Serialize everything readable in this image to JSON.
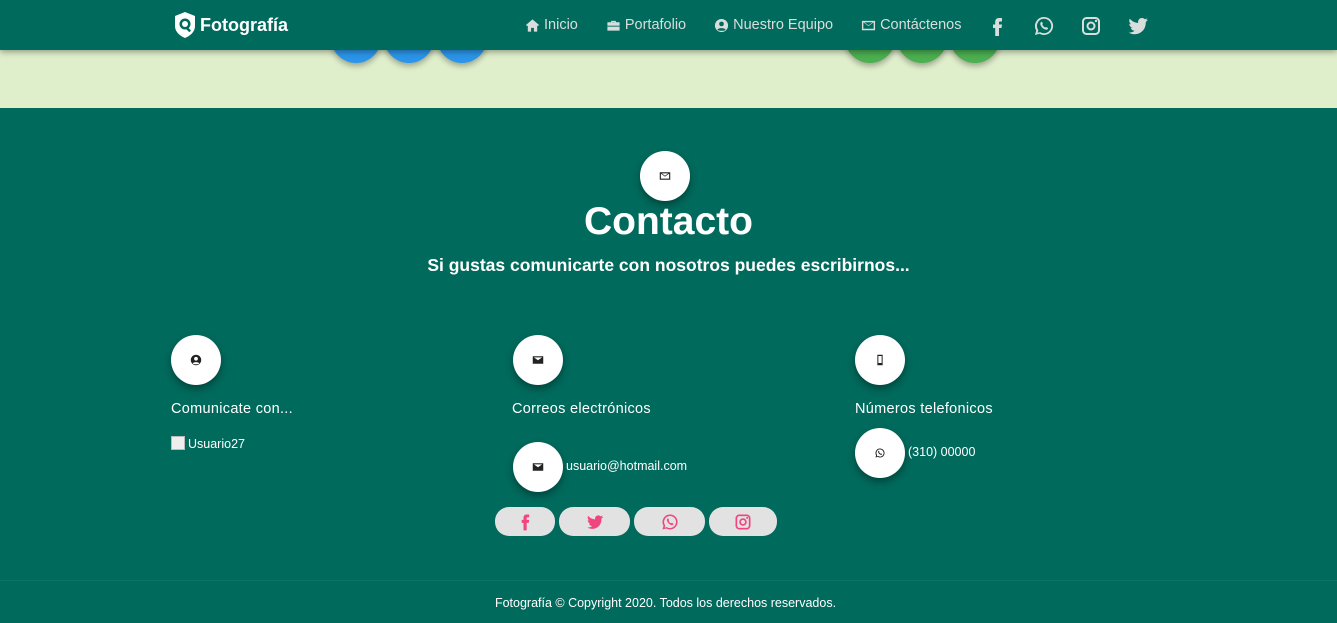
{
  "navbar": {
    "brand": "Fotografía",
    "links": [
      {
        "label": "Inicio",
        "icon": "home-icon"
      },
      {
        "label": "Portafolio",
        "icon": "briefcase-icon"
      },
      {
        "label": "Nuestro Equipo",
        "icon": "user-circle-icon"
      },
      {
        "label": "Contáctenos",
        "icon": "envelope-icon"
      }
    ],
    "social": [
      "facebook-icon",
      "whatsapp-icon",
      "instagram-icon",
      "twitter-icon"
    ]
  },
  "colors": {
    "primary": "#006A5C",
    "light_strip": "#DFEECB",
    "blue_dot": "#2A95EA",
    "green_dot": "#4CAF50",
    "social_pill_bg": "#E2E2E2",
    "social_pill_icon": "#F0457E"
  },
  "contact": {
    "title": "Contacto",
    "subtitle": "Si gustas comunicarte con nosotros puedes escribirnos...",
    "columns": [
      {
        "heading": "Comunicate con...",
        "icon": "user-circle-icon",
        "item_icon": "broken-image-icon",
        "item": "Usuario27"
      },
      {
        "heading": "Correos electrónicos",
        "icon": "envelope-icon",
        "item_icon": "envelope-icon",
        "item": "usuario@hotmail.com"
      },
      {
        "heading": "Números telefonicos",
        "icon": "mobile-phone-icon",
        "item_icon": "whatsapp-icon",
        "item": "(310) 00000"
      }
    ],
    "social_buttons": [
      "facebook-icon",
      "twitter-icon",
      "whatsapp-icon",
      "instagram-icon"
    ]
  },
  "footer": {
    "text": "Fotografía © Copyright 2020. Todos los derechos reservados."
  }
}
